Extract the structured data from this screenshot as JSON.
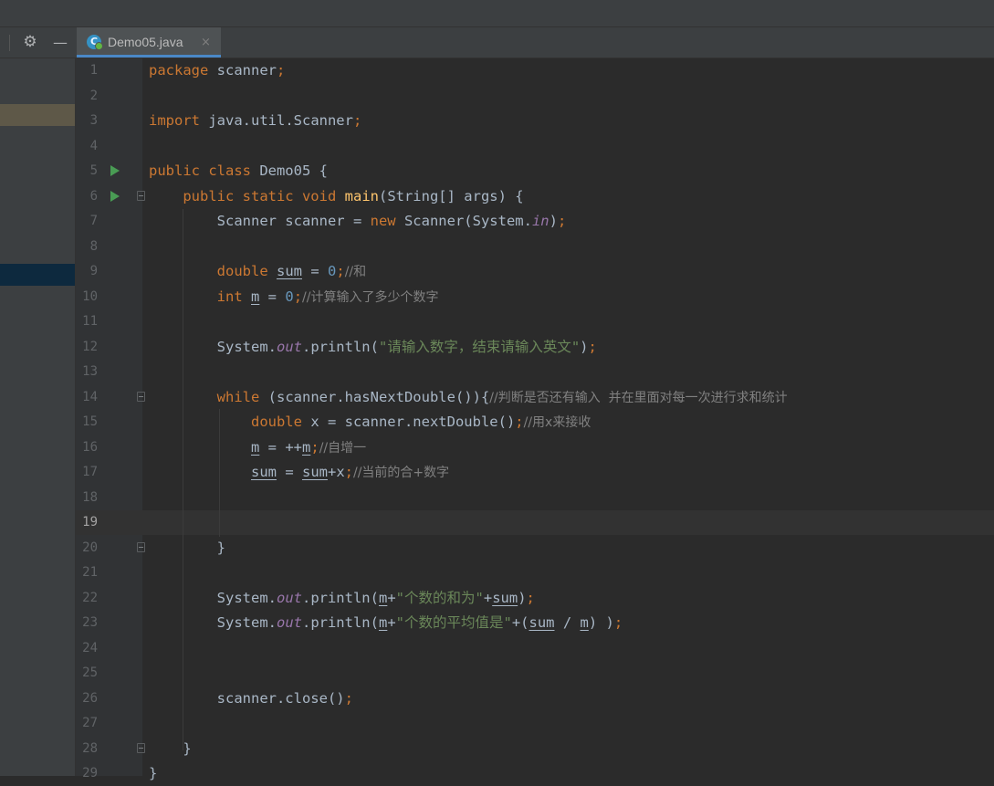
{
  "editor": {
    "tab": {
      "label": "Demo05.java",
      "icon": "class-icon",
      "icon_letter": "C",
      "close": "×"
    },
    "toolbar_icons": [
      "settings-gear-icon",
      "minimize-icon"
    ],
    "current_line": 19,
    "colors": {
      "keyword": "#cc7832",
      "string": "#6a8759",
      "comment": "#808080",
      "number": "#6897bb",
      "method": "#ffc66d",
      "static_field": "#9876aa",
      "text": "#a9b7c6",
      "tab_accent": "#4a88c7"
    },
    "lines": [
      {
        "n": "1",
        "t": [
          [
            "kw",
            "package"
          ],
          [
            "p",
            " scanner"
          ],
          [
            "kw",
            ";"
          ]
        ]
      },
      {
        "n": "2",
        "t": []
      },
      {
        "n": "3",
        "t": [
          [
            "kw",
            "import"
          ],
          [
            "p",
            " java.util.Scanner"
          ],
          [
            "kw",
            ";"
          ]
        ]
      },
      {
        "n": "4",
        "t": []
      },
      {
        "n": "5",
        "t": [
          [
            "kw",
            "public class"
          ],
          [
            "p",
            " Demo05 {"
          ]
        ],
        "run": true
      },
      {
        "n": "6",
        "t": [
          [
            "p",
            "    "
          ],
          [
            "kw",
            "public static void"
          ],
          [
            "p",
            " "
          ],
          [
            "fn",
            "main"
          ],
          [
            "p",
            "(String[] args) {"
          ]
        ],
        "run": true,
        "fold": true
      },
      {
        "n": "7",
        "t": [
          [
            "p",
            "        Scanner scanner = "
          ],
          [
            "kw",
            "new"
          ],
          [
            "p",
            " Scanner(System."
          ],
          [
            "st",
            "in"
          ],
          [
            "p",
            ")"
          ],
          [
            "kw",
            ";"
          ]
        ]
      },
      {
        "n": "8",
        "t": []
      },
      {
        "n": "9",
        "t": [
          [
            "p",
            "        "
          ],
          [
            "kw",
            "double"
          ],
          [
            "p",
            " "
          ],
          [
            "vr",
            "sum"
          ],
          [
            "p",
            " = "
          ],
          [
            "num",
            "0"
          ],
          [
            "kw",
            ";"
          ],
          [
            "cmt",
            "//和"
          ]
        ]
      },
      {
        "n": "10",
        "t": [
          [
            "p",
            "        "
          ],
          [
            "kw",
            "int"
          ],
          [
            "p",
            " "
          ],
          [
            "vr",
            "m"
          ],
          [
            "p",
            " = "
          ],
          [
            "num",
            "0"
          ],
          [
            "kw",
            ";"
          ],
          [
            "cmt",
            "//计算输入了多少个数字"
          ]
        ]
      },
      {
        "n": "11",
        "t": []
      },
      {
        "n": "12",
        "t": [
          [
            "p",
            "        System."
          ],
          [
            "st",
            "out"
          ],
          [
            "p",
            ".println("
          ],
          [
            "str",
            "\"请输入数字，结束请输入英文\""
          ],
          [
            "p",
            ")"
          ],
          [
            "kw",
            ";"
          ]
        ]
      },
      {
        "n": "13",
        "t": []
      },
      {
        "n": "14",
        "t": [
          [
            "p",
            "        "
          ],
          [
            "kw",
            "while"
          ],
          [
            "p",
            " (scanner.hasNextDouble()){"
          ],
          [
            "cmt",
            "//判断是否还有输入  并在里面对每一次进行求和统计"
          ]
        ],
        "fold": true
      },
      {
        "n": "15",
        "t": [
          [
            "p",
            "            "
          ],
          [
            "kw",
            "double"
          ],
          [
            "p",
            " x = scanner.nextDouble()"
          ],
          [
            "kw",
            ";"
          ],
          [
            "cmt",
            "//用x来接收"
          ]
        ]
      },
      {
        "n": "16",
        "t": [
          [
            "p",
            "            "
          ],
          [
            "vr",
            "m"
          ],
          [
            "p",
            " = ++"
          ],
          [
            "vr",
            "m"
          ],
          [
            "kw",
            ";"
          ],
          [
            "cmt",
            "//自增一"
          ]
        ]
      },
      {
        "n": "17",
        "t": [
          [
            "p",
            "            "
          ],
          [
            "vr",
            "sum"
          ],
          [
            "p",
            " = "
          ],
          [
            "vr",
            "sum"
          ],
          [
            "p",
            "+x"
          ],
          [
            "kw",
            ";"
          ],
          [
            "cmt",
            "//当前的合+数字"
          ]
        ]
      },
      {
        "n": "18",
        "t": []
      },
      {
        "n": "19",
        "t": []
      },
      {
        "n": "20",
        "t": [
          [
            "p",
            "        }"
          ]
        ],
        "fold": true
      },
      {
        "n": "21",
        "t": []
      },
      {
        "n": "22",
        "t": [
          [
            "p",
            "        System."
          ],
          [
            "st",
            "out"
          ],
          [
            "p",
            ".println("
          ],
          [
            "vr",
            "m"
          ],
          [
            "p",
            "+"
          ],
          [
            "str",
            "\"个数的和为\""
          ],
          [
            "p",
            "+"
          ],
          [
            "vr",
            "sum"
          ],
          [
            "p",
            ")"
          ],
          [
            "kw",
            ";"
          ]
        ]
      },
      {
        "n": "23",
        "t": [
          [
            "p",
            "        System."
          ],
          [
            "st",
            "out"
          ],
          [
            "p",
            ".println("
          ],
          [
            "vr",
            "m"
          ],
          [
            "p",
            "+"
          ],
          [
            "str",
            "\"个数的平均值是\""
          ],
          [
            "p",
            "+("
          ],
          [
            "vr",
            "sum"
          ],
          [
            "p",
            " / "
          ],
          [
            "vr",
            "m"
          ],
          [
            "p",
            ") )"
          ],
          [
            "kw",
            ";"
          ]
        ]
      },
      {
        "n": "24",
        "t": []
      },
      {
        "n": "25",
        "t": []
      },
      {
        "n": "26",
        "t": [
          [
            "p",
            "        scanner.close()"
          ],
          [
            "kw",
            ";"
          ]
        ]
      },
      {
        "n": "27",
        "t": []
      },
      {
        "n": "28",
        "t": [
          [
            "p",
            "    }"
          ]
        ],
        "fold": true
      },
      {
        "n": "29",
        "t": [
          [
            "p",
            "}"
          ]
        ]
      }
    ]
  }
}
